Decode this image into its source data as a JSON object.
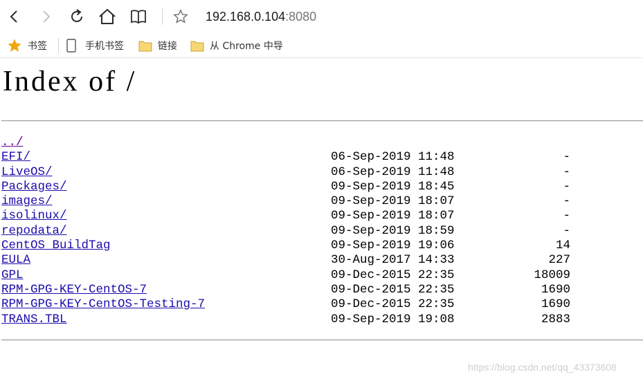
{
  "browser": {
    "address": {
      "host": "192.168.0.104",
      "port": ":8080"
    },
    "icons": {
      "back": "back-arrow-icon",
      "forward": "forward-arrow-icon",
      "reload": "reload-icon",
      "home": "home-icon",
      "reading": "book-icon",
      "favorite": "star-outline-icon"
    }
  },
  "bookmarks": [
    {
      "label": "书签",
      "icon": "star-icon"
    },
    {
      "label": "手机书签",
      "icon": "phone-icon"
    },
    {
      "label": "链接",
      "icon": "folder-icon"
    },
    {
      "label": "从 Chrome 中导",
      "icon": "folder-icon"
    }
  ],
  "page": {
    "title": "Index of /",
    "parent": {
      "label": "../"
    },
    "entries": [
      {
        "name": "EFI/",
        "date": "06-Sep-2019 11:48",
        "size": "-"
      },
      {
        "name": "LiveOS/",
        "date": "06-Sep-2019 11:48",
        "size": "-"
      },
      {
        "name": "Packages/",
        "date": "09-Sep-2019 18:45",
        "size": "-"
      },
      {
        "name": "images/",
        "date": "09-Sep-2019 18:07",
        "size": "-"
      },
      {
        "name": "isolinux/",
        "date": "09-Sep-2019 18:07",
        "size": "-"
      },
      {
        "name": "repodata/",
        "date": "09-Sep-2019 18:59",
        "size": "-"
      },
      {
        "name": "CentOS_BuildTag",
        "date": "09-Sep-2019 19:06",
        "size": "14"
      },
      {
        "name": "EULA",
        "date": "30-Aug-2017 14:33",
        "size": "227"
      },
      {
        "name": "GPL",
        "date": "09-Dec-2015 22:35",
        "size": "18009"
      },
      {
        "name": "RPM-GPG-KEY-CentOS-7",
        "date": "09-Dec-2015 22:35",
        "size": "1690"
      },
      {
        "name": "RPM-GPG-KEY-CentOS-Testing-7",
        "date": "09-Dec-2015 22:35",
        "size": "1690"
      },
      {
        "name": "TRANS.TBL",
        "date": "09-Sep-2019 19:08",
        "size": "2883"
      }
    ]
  },
  "watermark": "https://blog.csdn.net/qq_43373608",
  "colors": {
    "link": "#1a0dab",
    "visited": "#660099",
    "bookmark_star": "#f2a60c",
    "folder": "#f7d774"
  }
}
